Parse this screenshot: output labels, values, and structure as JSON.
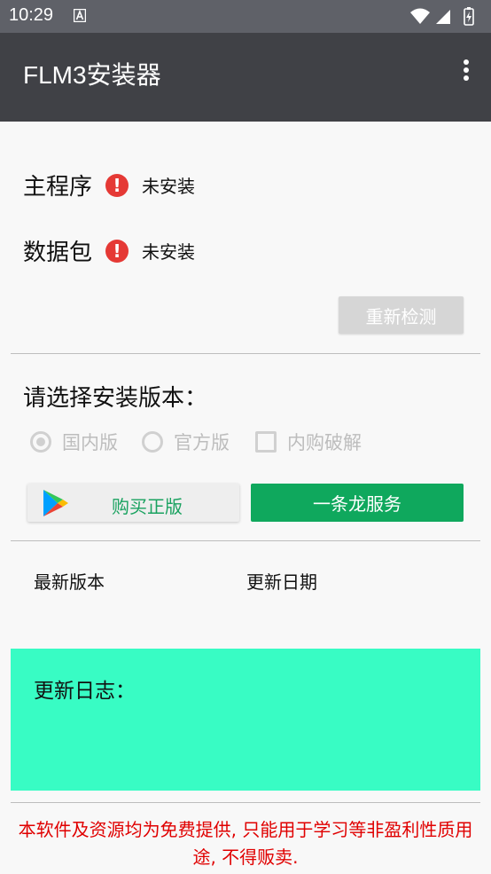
{
  "status_bar": {
    "time": "10:29"
  },
  "app_bar": {
    "title": "FLM3安装器",
    "menu_icon": "more-vert-icon"
  },
  "install_status": {
    "items": [
      {
        "label": "主程序",
        "status": "未安装",
        "icon": "alert-icon"
      },
      {
        "label": "数据包",
        "status": "未安装",
        "icon": "alert-icon"
      }
    ],
    "recheck_label": "重新检测"
  },
  "version_select": {
    "prompt": "请选择安装版本：",
    "options": [
      {
        "label": "国内版",
        "type": "radio",
        "checked": true
      },
      {
        "label": "官方版",
        "type": "radio",
        "checked": false
      },
      {
        "label": "内购破解",
        "type": "checkbox",
        "checked": false
      }
    ]
  },
  "actions": {
    "buy_label": "购买正版",
    "buy_icon": "google-play-icon",
    "service_label": "一条龙服务"
  },
  "version_info": {
    "latest_version_label": "最新版本",
    "update_date_label": "更新日期"
  },
  "changelog": {
    "title": "更新日志："
  },
  "disclaimer": "本软件及资源均为免费提供, 只能用于学习等非盈利性质用途, 不得贩卖.",
  "colors": {
    "app_bar": "#404146",
    "status_bar": "#5f6168",
    "alert": "#e53935",
    "service_button": "#0fa85d",
    "changelog_bg": "#38fcc4",
    "disclaimer": "#e00000"
  }
}
